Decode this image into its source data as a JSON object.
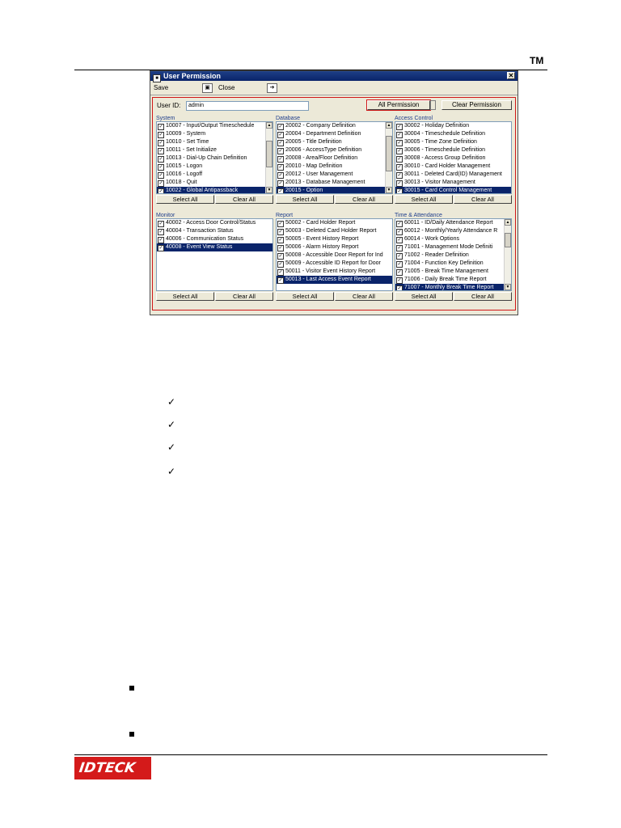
{
  "header": {
    "trademark": "TM"
  },
  "window": {
    "title": "User Permission",
    "toolbar": {
      "save_label": "Save",
      "close_label": "Close"
    },
    "user_id_label": "User ID:",
    "user_id_value": "admin",
    "all_permission_label": "All Permission",
    "clear_permission_label": "Clear Permission",
    "select_all_label": "Select All",
    "clear_all_label": "Clear All",
    "groups": [
      {
        "key": "system",
        "label": "System",
        "scroll": true,
        "thumb_top": 0.2,
        "thumb_size": 0.45,
        "items": [
          {
            "text": "10007 - Input/Output Timeschedule",
            "checked": true,
            "selected": false
          },
          {
            "text": "10009 - System",
            "checked": true,
            "selected": false
          },
          {
            "text": "10010 - Set Time",
            "checked": true,
            "selected": false
          },
          {
            "text": "10011 - Set Initialize",
            "checked": true,
            "selected": false
          },
          {
            "text": "10013 - Dial-Up Chain Definition",
            "checked": true,
            "selected": false
          },
          {
            "text": "10015 - Logon",
            "checked": true,
            "selected": false
          },
          {
            "text": "10016 - Logoff",
            "checked": true,
            "selected": false
          },
          {
            "text": "10018 - Quit",
            "checked": true,
            "selected": false
          },
          {
            "text": "10022 - Global Antipassback",
            "checked": true,
            "selected": true
          }
        ]
      },
      {
        "key": "database",
        "label": "Database",
        "scroll": true,
        "thumb_top": 0.12,
        "thumb_size": 0.6,
        "items": [
          {
            "text": "20002 - Company Definition",
            "checked": true,
            "selected": false
          },
          {
            "text": "20004 - Department Definition",
            "checked": true,
            "selected": false
          },
          {
            "text": "20005 - Title Definition",
            "checked": true,
            "selected": false
          },
          {
            "text": "20006 - AccessType Definition",
            "checked": true,
            "selected": false
          },
          {
            "text": "20008 - Area/Floor Definition",
            "checked": true,
            "selected": false
          },
          {
            "text": "20010 - Map Definition",
            "checked": true,
            "selected": false
          },
          {
            "text": "20012 - User Management",
            "checked": true,
            "selected": false
          },
          {
            "text": "20013 - Database Management",
            "checked": true,
            "selected": false
          },
          {
            "text": "20015 - Option",
            "checked": true,
            "selected": true
          }
        ]
      },
      {
        "key": "access_control",
        "label": "Access Control",
        "scroll": false,
        "items": [
          {
            "text": "30002 - Holiday Definition",
            "checked": true,
            "selected": false
          },
          {
            "text": "30004 - Timeschedule Definition",
            "checked": true,
            "selected": false
          },
          {
            "text": "30005 - Time Zone Definition",
            "checked": true,
            "selected": false
          },
          {
            "text": "30006 - Timeschedule Definition",
            "checked": true,
            "selected": false
          },
          {
            "text": "30008 - Access Group Definition",
            "checked": true,
            "selected": false
          },
          {
            "text": "30010 - Card Holder Management",
            "checked": true,
            "selected": false
          },
          {
            "text": "30011 - Deleted Card(ID) Management",
            "checked": true,
            "selected": false
          },
          {
            "text": "30013 - Visitor Management",
            "checked": true,
            "selected": false
          },
          {
            "text": "30015 - Card Control Management",
            "checked": true,
            "selected": true
          }
        ]
      },
      {
        "key": "monitor",
        "label": "Monitor",
        "scroll": false,
        "items": [
          {
            "text": "40002 - Access Door Control/Status",
            "checked": true,
            "selected": false
          },
          {
            "text": "40004 - Transaction Status",
            "checked": true,
            "selected": false
          },
          {
            "text": "40006 - Communication Status",
            "checked": true,
            "selected": false
          },
          {
            "text": "40008 - Event View Status",
            "checked": true,
            "selected": true
          }
        ]
      },
      {
        "key": "report",
        "label": "Report",
        "scroll": false,
        "items": [
          {
            "text": "50002 - Card Holder Report",
            "checked": true,
            "selected": false
          },
          {
            "text": "50003 - Deleted Card Holder Report",
            "checked": true,
            "selected": false
          },
          {
            "text": "50005 - Event History Report",
            "checked": true,
            "selected": false
          },
          {
            "text": "50006 - Alarm History Report",
            "checked": true,
            "selected": false
          },
          {
            "text": "50008 - Accessible Door Report for Ind",
            "checked": true,
            "selected": false
          },
          {
            "text": "50009 - Accessible ID Report for Door",
            "checked": true,
            "selected": false
          },
          {
            "text": "50011 - Visitor Event History Report",
            "checked": true,
            "selected": false
          },
          {
            "text": "50013 - Last Access Event Report",
            "checked": true,
            "selected": true
          }
        ]
      },
      {
        "key": "time_attendance",
        "label": "Time & Attendance",
        "scroll": true,
        "thumb_top": 0.12,
        "thumb_size": 0.25,
        "items": [
          {
            "text": "60011 - ID/Daily Attendance Report",
            "checked": true,
            "selected": false
          },
          {
            "text": "60012 - Monthly/Yearly Attendance R",
            "checked": true,
            "selected": false
          },
          {
            "text": "60014 - Work Options",
            "checked": true,
            "selected": false
          },
          {
            "text": "71001 - Management Mode Definiti",
            "checked": true,
            "selected": false
          },
          {
            "text": "71002 - Reader Definition",
            "checked": true,
            "selected": false
          },
          {
            "text": "71004 - Function Key Definition",
            "checked": true,
            "selected": false
          },
          {
            "text": "71005 - Break Time Management",
            "checked": true,
            "selected": false
          },
          {
            "text": "71006 - Daily Break Time Report",
            "checked": true,
            "selected": false
          },
          {
            "text": "71007 - Monthly Break Time Report",
            "checked": true,
            "selected": true
          }
        ]
      }
    ]
  },
  "checklist": {
    "mark": "✓",
    "count": 4
  },
  "bullets": {
    "count": 2
  },
  "footer": {
    "logo_text": "IDTECK",
    "brand_color": "#d41a1a"
  },
  "icons": {
    "save": "save-icon",
    "close": "close-icon",
    "checkbox": "checkbox-icon",
    "bullet": "square-bullet-icon"
  }
}
